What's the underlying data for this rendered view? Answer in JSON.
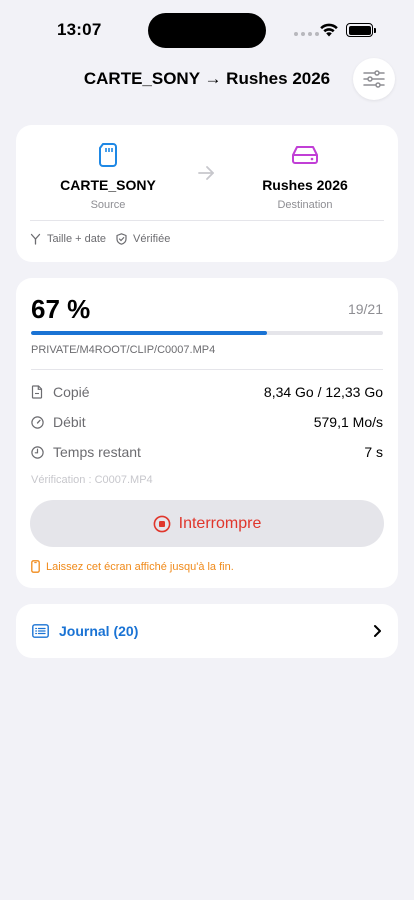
{
  "status_bar": {
    "time": "13:07"
  },
  "header": {
    "title": "CARTE_SONY → Rushes 2026"
  },
  "transfer": {
    "source": {
      "name": "CARTE_SONY",
      "role": "Source"
    },
    "destination": {
      "name": "Rushes 2026",
      "role": "Destination"
    },
    "options": [
      {
        "icon": "fork-icon",
        "label": "Taille + date"
      },
      {
        "icon": "shield-check-icon",
        "label": "Vérifiée"
      }
    ]
  },
  "progress": {
    "percent_label": "67 %",
    "percent_value": 0.67,
    "count": "19/21",
    "current_file": "PRIVATE/M4ROOT/CLIP/C0007.MP4",
    "stats": [
      {
        "icon": "file-icon",
        "label": "Copié",
        "value": "8,34 Go / 12,33 Go"
      },
      {
        "icon": "speedometer-icon",
        "label": "Débit",
        "value": "579,1 Mo/s"
      },
      {
        "icon": "clock-icon",
        "label": "Temps restant",
        "value": "7 s"
      }
    ],
    "verification": "Vérification : C0007.MP4",
    "stop_label": "Interrompre",
    "warning": "Laissez cet écran affiché jusqu'à la fin."
  },
  "journal": {
    "label": "Journal (20)"
  },
  "colors": {
    "accent": "#1a73d4",
    "source_icon": "#1e88e5",
    "destination_icon": "#c13fd6",
    "danger": "#e0362c",
    "warning": "#f08a1a",
    "background": "#f2f2f7"
  }
}
